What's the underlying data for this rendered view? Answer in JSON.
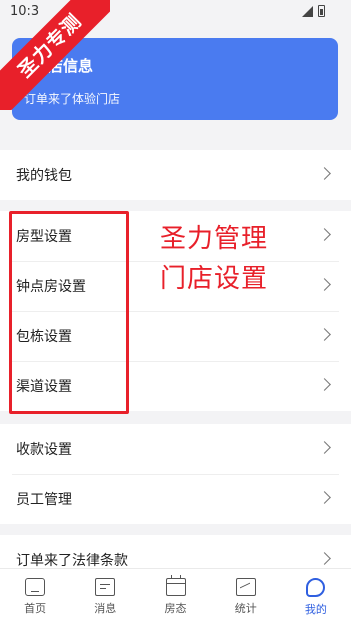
{
  "status_bar": {
    "time": "10:3"
  },
  "watermark": {
    "text": "圣力专测"
  },
  "store_card": {
    "title": "店信息",
    "store_name": "订单来了体验门店"
  },
  "menu_groups": [
    {
      "items": [
        {
          "label": "我的钱包"
        }
      ]
    },
    {
      "items": [
        {
          "label": "房型设置"
        },
        {
          "label": "钟点房设置"
        },
        {
          "label": "包栋设置"
        },
        {
          "label": "渠道设置"
        }
      ]
    },
    {
      "items": [
        {
          "label": "收款设置"
        },
        {
          "label": "员工管理"
        }
      ]
    },
    {
      "items": [
        {
          "label": "订单来了法律条款"
        }
      ]
    }
  ],
  "annotation": {
    "line1": "圣力管理",
    "line2": "门店设置",
    "color": "#e8202a"
  },
  "tab_bar": {
    "tabs": [
      {
        "label": "首页",
        "icon": "home-icon"
      },
      {
        "label": "消息",
        "icon": "message-icon"
      },
      {
        "label": "房态",
        "icon": "calendar-icon"
      },
      {
        "label": "统计",
        "icon": "stats-icon"
      },
      {
        "label": "我的",
        "icon": "profile-icon",
        "active": true
      }
    ],
    "active_color": "#2f5fe0"
  }
}
